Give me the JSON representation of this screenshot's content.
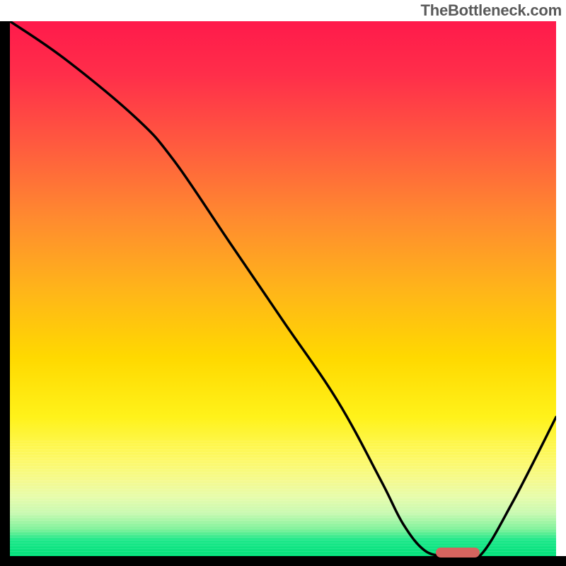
{
  "watermark": "TheBottleneck.com",
  "colors": {
    "gradient_top": "#ff1a4b",
    "gradient_bottom": "#00e07a",
    "axis": "#000000",
    "curve": "#000000",
    "marker": "#d6645f"
  },
  "chart_data": {
    "type": "line",
    "title": "",
    "xlabel": "",
    "ylabel": "",
    "xlim": [
      0,
      100
    ],
    "ylim": [
      0,
      100
    ],
    "x": [
      0,
      10,
      23,
      30,
      40,
      50,
      60,
      68,
      72,
      76,
      80,
      82,
      86,
      92,
      100
    ],
    "values": [
      100,
      93,
      82,
      74,
      59,
      44,
      29,
      14,
      6,
      1,
      0,
      0,
      0,
      10,
      26
    ],
    "marker": {
      "x_start": 78,
      "x_end": 86,
      "y": 0
    },
    "background_gradient": {
      "type": "vertical",
      "stops": [
        {
          "pos": 0.0,
          "color": "#ff1a4b"
        },
        {
          "pos": 0.5,
          "color": "#ffb41a"
        },
        {
          "pos": 0.8,
          "color": "#fdf968"
        },
        {
          "pos": 0.92,
          "color": "#c8f9b1"
        },
        {
          "pos": 1.0,
          "color": "#00e07a"
        }
      ]
    }
  }
}
